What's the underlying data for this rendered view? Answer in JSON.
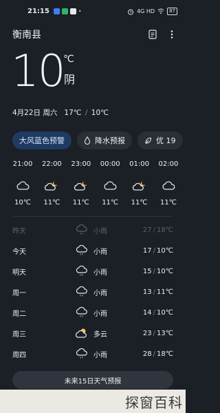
{
  "status": {
    "time": "21:15",
    "signal": "4G HD",
    "battery": "87"
  },
  "header": {
    "city": "衡南县",
    "list_icon": "city-list-icon",
    "more_icon": "more-vertical-icon"
  },
  "current": {
    "temp": "10",
    "unit": "℃",
    "condition": "阴"
  },
  "date_line": {
    "date": "4月22日",
    "weekday": "周六",
    "high": "17℃",
    "sep": "/",
    "low": "10℃"
  },
  "chips": {
    "warning": "大风蓝色预警",
    "precip": "降水预报",
    "aqi": "优 19"
  },
  "hourly": [
    {
      "time": "21:00",
      "icon": "cloudy-icon",
      "temp": "10℃"
    },
    {
      "time": "22:00",
      "icon": "cloudy-moon-icon",
      "temp": "11℃"
    },
    {
      "time": "23:00",
      "icon": "cloudy-moon-icon",
      "temp": "11℃"
    },
    {
      "time": "00:00",
      "icon": "cloudy-icon",
      "temp": "11℃"
    },
    {
      "time": "01:00",
      "icon": "cloudy-moon-icon",
      "temp": "11℃"
    },
    {
      "time": "02:00",
      "icon": "cloudy-icon",
      "temp": "11℃"
    }
  ],
  "daily": [
    {
      "day": "昨天",
      "icon": "light-rain-icon",
      "cond": "小雨",
      "high": "27",
      "low": "18℃"
    },
    {
      "day": "今天",
      "icon": "light-rain-icon",
      "cond": "小雨",
      "high": "17",
      "low": "10℃"
    },
    {
      "day": "明天",
      "icon": "light-rain-icon",
      "cond": "小雨",
      "high": "15",
      "low": "10℃"
    },
    {
      "day": "周一",
      "icon": "light-rain-icon",
      "cond": "小雨",
      "high": "13",
      "low": "11℃"
    },
    {
      "day": "周二",
      "icon": "light-rain-icon",
      "cond": "小雨",
      "high": "14",
      "low": "10℃"
    },
    {
      "day": "周三",
      "icon": "partly-cloudy-icon",
      "cond": "多云",
      "high": "23",
      "low": "13℃"
    },
    {
      "day": "周四",
      "icon": "light-rain-icon",
      "cond": "小雨",
      "high": "28",
      "low": "18℃"
    }
  ],
  "sep": "/",
  "forecast_button": "未来15日天气预报",
  "watermark": "探窗百科",
  "colors": {
    "background": "#1b1f26",
    "warning_chip": "#1f3a63",
    "sun": "#f5c242",
    "rain_drop": "#4a9cf0"
  }
}
